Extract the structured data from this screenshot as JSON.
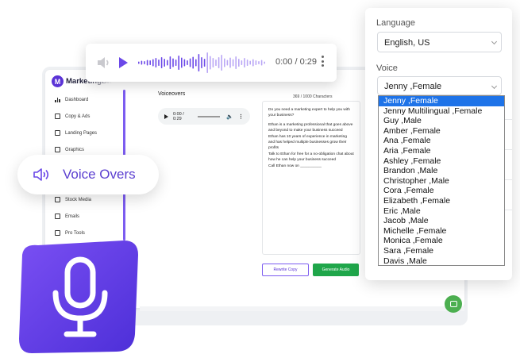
{
  "app": {
    "brand": "MarketingBlocks",
    "logo_letter": "M",
    "nav": [
      {
        "label": "Dashboard",
        "icon": "bar-chart-icon"
      },
      {
        "label": "Copy & Ads",
        "icon": "copy-icon"
      },
      {
        "label": "Landing Pages",
        "icon": "page-icon"
      },
      {
        "label": "Graphics",
        "icon": "image-icon"
      },
      {
        "label": "Stock Media",
        "icon": "media-icon"
      },
      {
        "label": "Emails",
        "icon": "mail-icon"
      },
      {
        "label": "Pro Tools",
        "icon": "tools-icon"
      }
    ],
    "voiceovers_title": "Voiceovers",
    "mini_player_time": "0:00 / 0:29",
    "char_count": "369 / 1000 Characters",
    "script_paragraphs": [
      "Do you need a marketing expert to help you with your business?",
      "Ethan is a marketing professional that goes above and beyond to make your business succeed",
      "Ethan has 10 years of experience in marketing and has helped multiple businesses grow their profits",
      "Talk to Ethan for free for a no-obligation chat about how he can help your business succeed",
      "Call Ethan now on __________"
    ],
    "rewrite_label": "Rewrite Copy",
    "generate_label": "Generate Audio"
  },
  "player": {
    "time": "0:00 / 0:29",
    "accent": "#6b48e8"
  },
  "pill": {
    "label": "Voice Overs",
    "icon": "speaker-wave-icon"
  },
  "panel": {
    "language_label": "Language",
    "language_value": "English, US",
    "voice_label": "Voice",
    "voice_value": "Jenny ,Female",
    "voice_options": [
      "Jenny ,Female",
      "Jenny Multilingual ,Female",
      "Guy ,Male",
      "Amber ,Female",
      "Ana ,Female",
      "Aria ,Female",
      "Ashley ,Female",
      "Brandon ,Male",
      "Christopher ,Male",
      "Cora ,Female",
      "Elizabeth ,Female",
      "Eric ,Male",
      "Jacob ,Male",
      "Michelle ,Female",
      "Monica ,Female",
      "Sara ,Female",
      "Davis ,Male"
    ],
    "selected_index": 0,
    "highlight_color": "#1e73e8"
  },
  "colors": {
    "brand_purple": "#5b33d6",
    "generate_green": "#1fa64a",
    "chat_green": "#4caf50"
  }
}
